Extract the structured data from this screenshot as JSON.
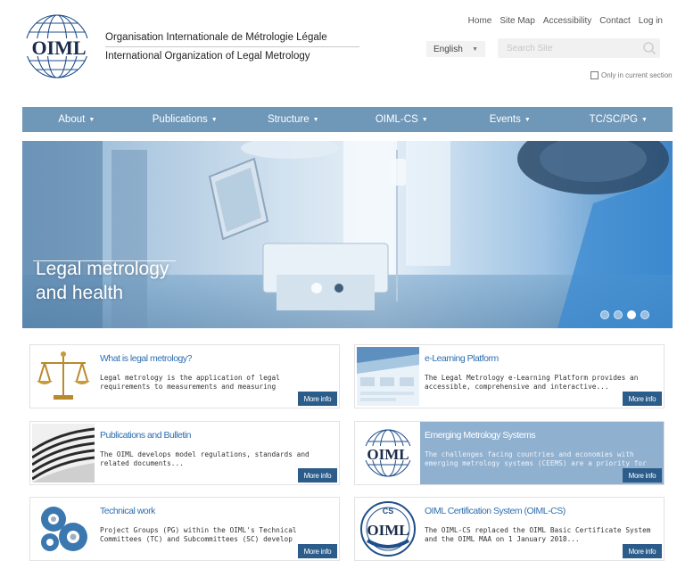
{
  "header": {
    "org_name_fr": "Organisation Internationale de Métrologie Légale",
    "org_name_en": "International Organization of Legal Metrology",
    "logo_text": "OIML",
    "top_links": [
      "Home",
      "Site Map",
      "Accessibility",
      "Contact",
      "Log in"
    ],
    "language": "English",
    "search_placeholder": "Search Site",
    "only_current_section": "Only in current section"
  },
  "nav": [
    "About",
    "Publications",
    "Structure",
    "OIML-CS",
    "Events",
    "TC/SC/PG"
  ],
  "hero": {
    "title_line1": "Legal metrology",
    "title_line2": "and health",
    "slides": 4,
    "active_slide": 3
  },
  "cards": [
    {
      "title": "What is legal metrology?",
      "desc": "Legal metrology is the application of legal requirements to measurements and measuring instruments...",
      "more": "More info",
      "icon": "scales-of-justice-icon"
    },
    {
      "title": "e-Learning Platform",
      "desc": "The Legal Metrology e-Learning Platform provides an accessible, comprehensive and interactive...",
      "more": "More info",
      "icon": "elearning-screenshot-icon"
    },
    {
      "title": "Publications and Bulletin",
      "desc": "The OIML develops model regulations, standards and related documents...",
      "more": "More info",
      "icon": "publications-icon"
    },
    {
      "title": "Emerging Metrology Systems",
      "desc": "The challenges facing countries and economies with emerging metrology systems (CEEMS) are a priority for the OIML...",
      "more": "More info",
      "icon": "oiml-globe-logo-icon"
    },
    {
      "title": "Technical work",
      "desc": "Project Groups (PG) within the OIML's Technical Committees (TC) and Subcommittees (SC) develop technical publications...",
      "more": "More info",
      "icon": "gears-icon"
    },
    {
      "title": "OIML Certification System (OIML-CS)",
      "desc": "The OIML-CS replaced the OIML Basic Certificate System and the OIML MAA on 1 January 2018...",
      "more": "More info",
      "icon": "oiml-cs-seal-icon"
    }
  ],
  "colors": {
    "nav_bg": "#6f97b8",
    "link_blue": "#2f6fb0",
    "button_blue": "#2b5c8a",
    "highlight_bg": "#8fb0cf"
  }
}
